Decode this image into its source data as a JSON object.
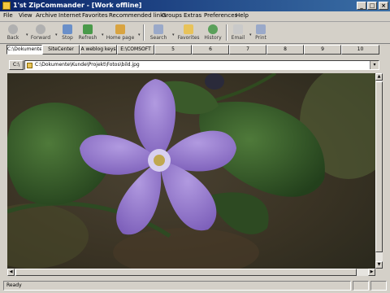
{
  "window": {
    "title": "1'st ZipCommander - [Work offline]",
    "controls": [
      "_",
      "□",
      "×"
    ]
  },
  "menu": [
    "File",
    "View",
    "Archive",
    "Internet",
    "Favorites",
    "Recommended links",
    "Groups",
    "Extras",
    "Preferences",
    "Help"
  ],
  "toolbar": {
    "back": "Back",
    "forward": "Forward",
    "stop": "Stop",
    "refresh": "Refresh",
    "home": "Home page",
    "search": "Search",
    "favorites": "Favorites",
    "history": "History",
    "email": "Email",
    "print": "Print"
  },
  "tabs": [
    "C:\\Dokumente",
    "SiteCenter",
    "A weblog keys",
    "E:\\COMSOFT",
    "5",
    "6",
    "7",
    "8",
    "9",
    "10"
  ],
  "address": {
    "label": "C:\\",
    "value": "C:\\Dokumente\\Kunde\\Projekt\\Fotos\\bild.jpg"
  },
  "status": {
    "text": "Ready"
  },
  "colors": {
    "titlebar_start": "#0a246a",
    "titlebar_end": "#3a6ea5",
    "face": "#d4d0c8",
    "flower": "#8d6fc4"
  }
}
